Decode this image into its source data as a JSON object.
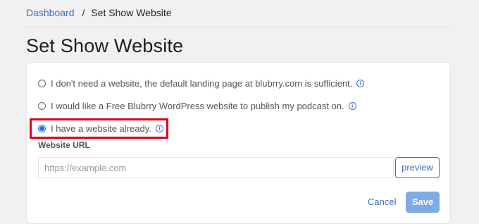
{
  "breadcrumb": {
    "parent": "Dashboard",
    "separator": "/",
    "current": "Set Show Website"
  },
  "page_title": "Set Show Website",
  "options": [
    {
      "label": "I don't need a website, the default landing page at blubrry.com is sufficient.",
      "selected": false
    },
    {
      "label": "I would like a Free Blubrry WordPress website to publish my podcast on.",
      "selected": false
    },
    {
      "label": "I have a website already.",
      "selected": true
    }
  ],
  "info_icon_glyph": "i",
  "website_url": {
    "label": "Website URL",
    "placeholder": "https://example.com",
    "value": ""
  },
  "preview_button": "preview",
  "actions": {
    "cancel": "Cancel",
    "save": "Save"
  },
  "colors": {
    "accent": "#3a6fc4",
    "highlight": "#e0001b",
    "save_button": "#7eaae6",
    "background": "#f1f1f1"
  }
}
